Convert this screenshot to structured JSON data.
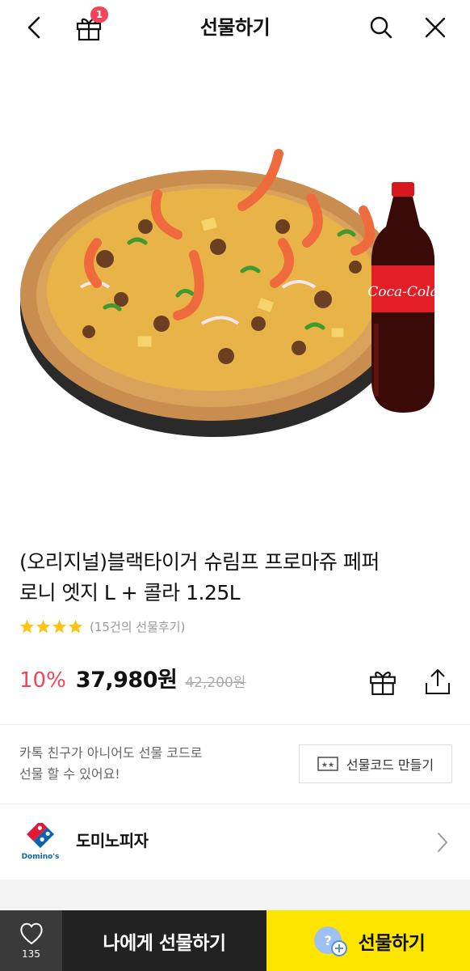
{
  "header": {
    "title": "선물하기",
    "gift_badge": "1",
    "icons": [
      "back-arrow-icon",
      "gift-icon",
      "search-icon",
      "close-icon"
    ]
  },
  "product": {
    "name_line1": "(오리지널)블랙타이거 슈림프 프로마쥬 페퍼",
    "name_line2": "로니 엣지 L + 콜라 1.25L",
    "rating_stars": 4,
    "review_text": "(15건의 선물후기)",
    "discount": "10%",
    "sale_price": "37,980원",
    "original_price": "42,200원",
    "bottle_label": "Coca-Cola"
  },
  "gift_code": {
    "text_line1": "카톡 친구가 아니어도 선물 코드로",
    "text_line2": "선물 할 수 있어요!",
    "button_label": "선물코드 만들기"
  },
  "brand": {
    "name": "도미노피자",
    "logo_text": "Domino's"
  },
  "bottom_bar": {
    "like_count": "135",
    "self_gift_label": "나에게 선물하기",
    "gift_label": "선물하기"
  },
  "colors": {
    "accent_red": "#f2455a",
    "kakao_yellow": "#fee500",
    "dark": "#222222",
    "star": "#fcc419"
  }
}
